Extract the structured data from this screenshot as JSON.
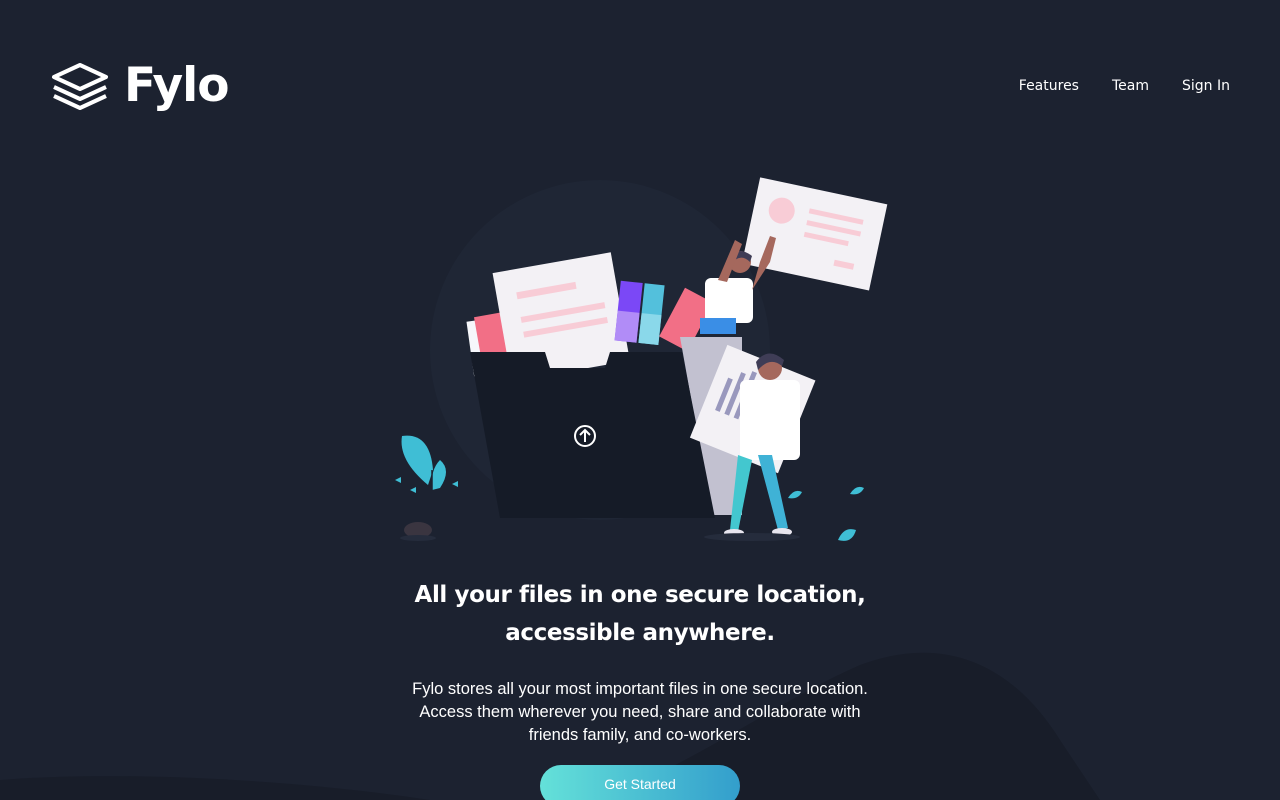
{
  "brand": {
    "name": "Fylo",
    "logo_icon": "stacked-layers-icon"
  },
  "nav": {
    "items": [
      {
        "label": "Features"
      },
      {
        "label": "Team"
      },
      {
        "label": "Sign In"
      }
    ]
  },
  "hero": {
    "title_line1": "All your files in one secure location,",
    "title_line2": "accessible anywhere.",
    "description_line1": "Fylo stores all your most important files in one secure location.",
    "description_line2": "Access them wherever you need, share and collaborate with",
    "description_line3": "friends family, and co-workers.",
    "cta_label": "Get Started",
    "illustration_icon": "upload-arrow-icon"
  },
  "colors": {
    "background": "#1c2230",
    "background_curve": "#181d29",
    "cta_gradient_start": "#64e1d9",
    "cta_gradient_end": "#339ecc",
    "text": "#ffffff"
  }
}
